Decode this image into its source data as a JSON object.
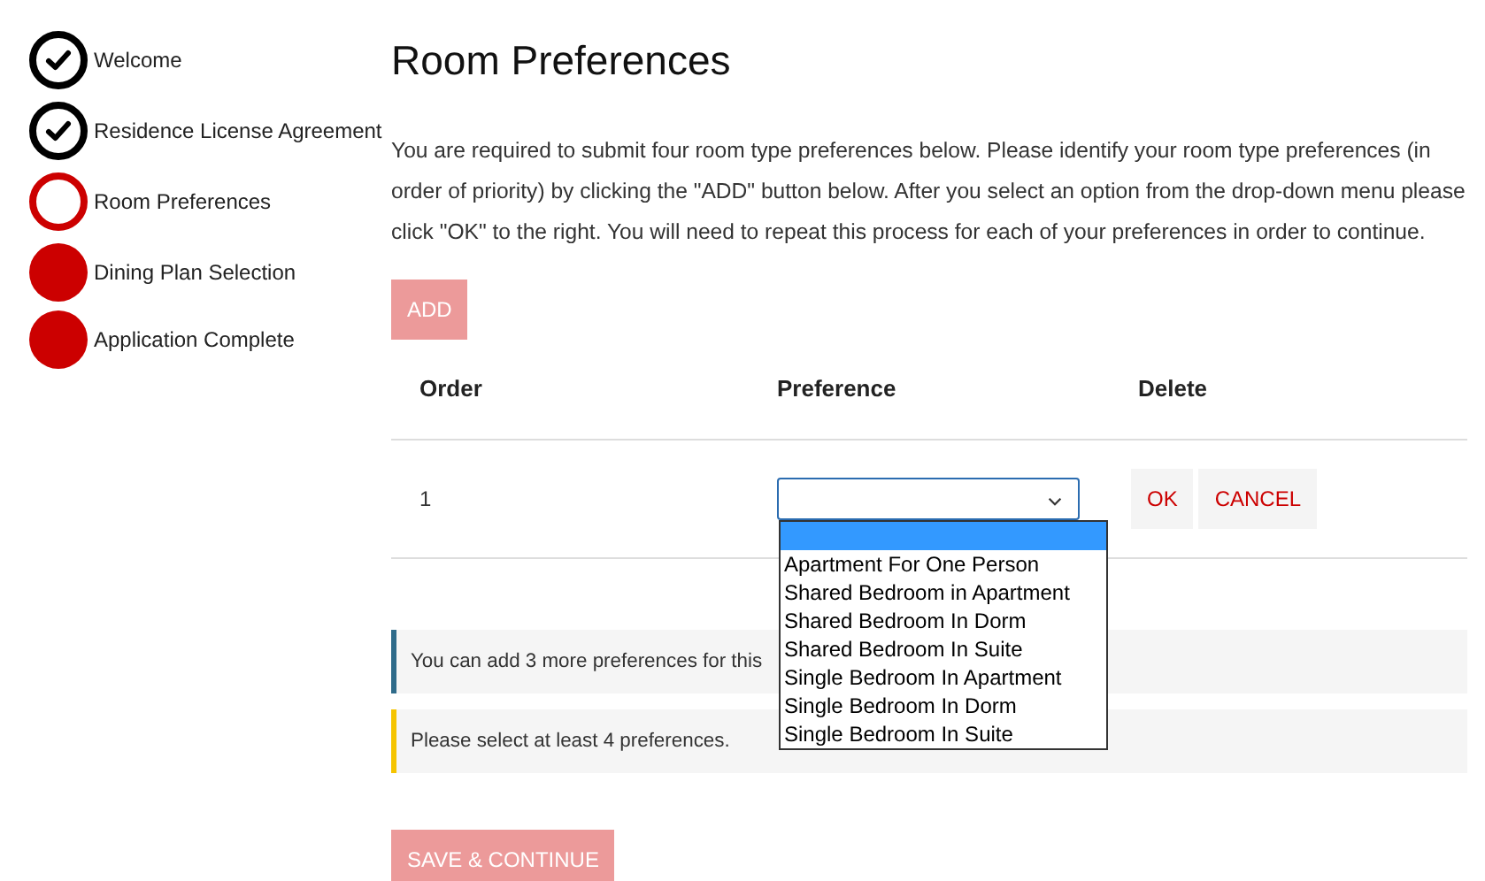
{
  "steps": [
    {
      "label": "Welcome",
      "kind": "done"
    },
    {
      "label": "Residence License Agreement",
      "kind": "done"
    },
    {
      "label": "Room Preferences",
      "kind": "current"
    },
    {
      "label": "Dining Plan Selection",
      "kind": "pending"
    },
    {
      "label": "Application Complete",
      "kind": "pending"
    }
  ],
  "title": "Room Preferences",
  "intro": "You are required to submit four room type preferences below. Please identify your room type preferences (in order of priority) by clicking the \"ADD\" button below. After you select an option from the drop-down menu please click \"OK\" to the right. You will need to repeat this process for each of your preferences in order to continue.",
  "add_button": "ADD",
  "table": {
    "columns": [
      "Order",
      "Preference",
      "Delete"
    ],
    "rows": [
      {
        "order": "1",
        "actions": [
          "OK",
          "CANCEL"
        ],
        "dropdown": {
          "expanded": true,
          "options": [
            {
              "selected": true
            },
            {
              "label": "Apartment For One Person",
              "selected": false
            },
            {
              "label": "Shared Bedroom in Apartment",
              "selected": false
            },
            {
              "label": "Shared Bedroom In Dorm",
              "selected": false
            },
            {
              "label": "Shared Bedroom In Suite",
              "selected": false
            },
            {
              "label": "Single Bedroom In Apartment",
              "selected": false
            },
            {
              "label": "Single Bedroom In Dorm",
              "selected": false
            },
            {
              "label": "Single Bedroom In Suite",
              "selected": false
            }
          ]
        }
      }
    ]
  },
  "notices": [
    {
      "kind": "info",
      "text": "You can add 3 more preferences for this"
    },
    {
      "kind": "warning",
      "text": "Please select at least 4 preferences."
    }
  ],
  "save_button": "SAVE & CONTINUE"
}
